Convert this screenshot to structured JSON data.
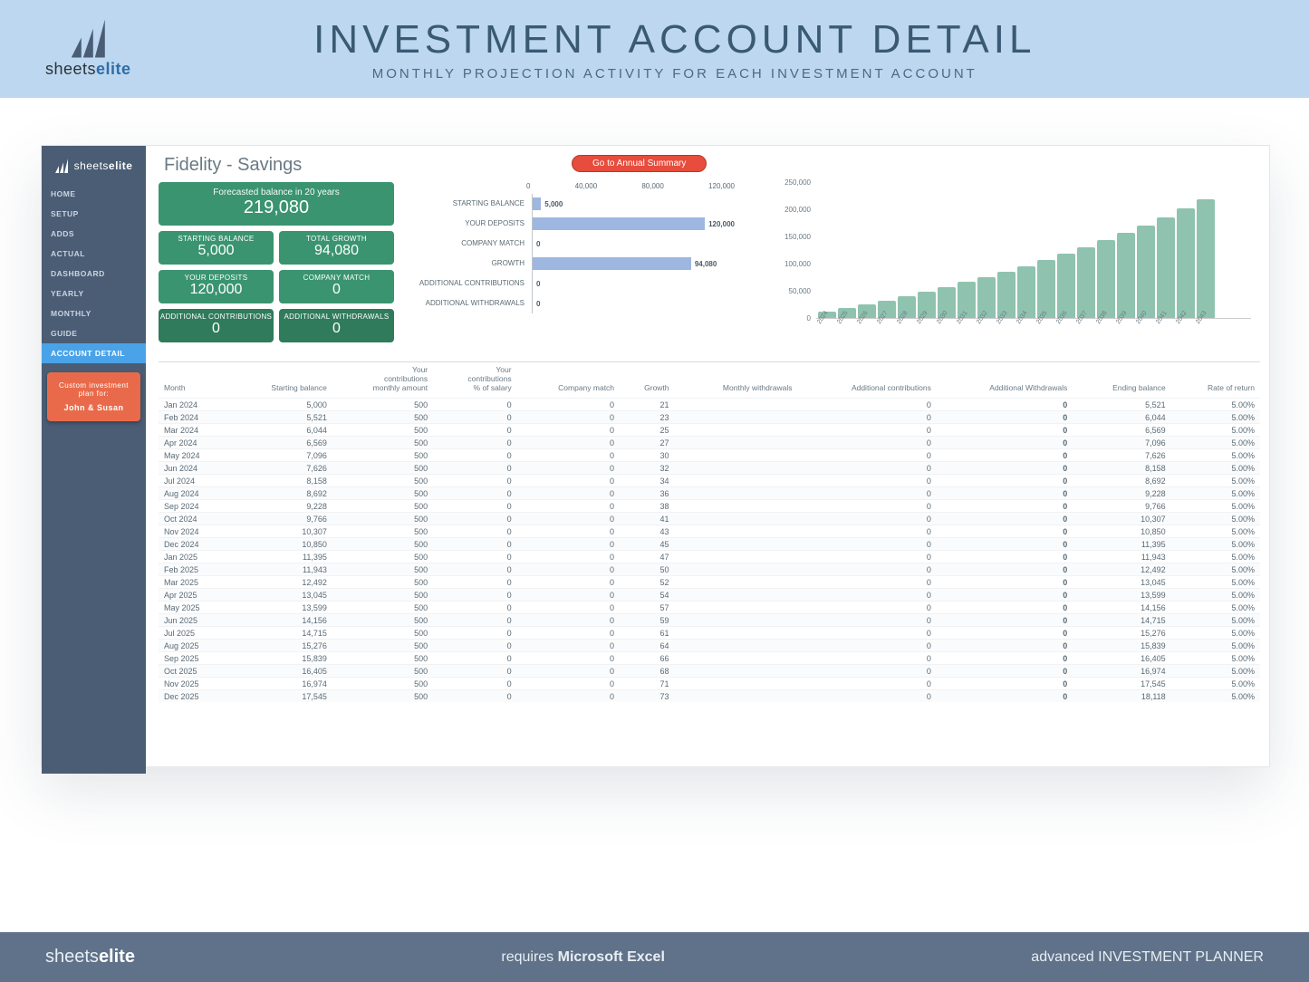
{
  "brand": {
    "a": "sheets",
    "b": "elite"
  },
  "banner": {
    "title": "INVESTMENT ACCOUNT DETAIL",
    "subtitle": "MONTHLY PROJECTION ACTIVITY FOR EACH INVESTMENT ACCOUNT"
  },
  "sidebar": {
    "items": [
      "HOME",
      "SETUP",
      "ADDS",
      "ACTUAL",
      "DASHBOARD",
      "YEARLY",
      "MONTHLY",
      "GUIDE",
      "ACCOUNT DETAIL"
    ],
    "active": "ACCOUNT DETAIL",
    "plan": {
      "label": "Custom investment plan for:",
      "name": "John & Susan"
    }
  },
  "account": {
    "title": "Fidelity - Savings"
  },
  "summary_btn": "Go to Annual Summary",
  "cards": {
    "forecast": {
      "label": "Forecasted balance in 20 years",
      "value": "219,080"
    },
    "starting": {
      "label": "STARTING BALANCE",
      "value": "5,000"
    },
    "growth": {
      "label": "TOTAL GROWTH",
      "value": "94,080"
    },
    "deposits": {
      "label": "YOUR DEPOSITS",
      "value": "120,000"
    },
    "match": {
      "label": "COMPANY MATCH",
      "value": "0"
    },
    "addc": {
      "label": "ADDITIONAL CONTRIBUTIONS",
      "value": "0"
    },
    "addw": {
      "label": "ADDITIONAL WITHDRAWALS",
      "value": "0"
    }
  },
  "chart_data": [
    {
      "type": "bar",
      "orientation": "horizontal",
      "categories": [
        "STARTING BALANCE",
        "YOUR DEPOSITS",
        "COMPANY MATCH",
        "GROWTH",
        "ADDITIONAL CONTRIBUTIONS",
        "ADDITIONAL WITHDRAWALS"
      ],
      "values": [
        5000,
        120000,
        0,
        94080,
        0,
        0
      ],
      "xticks": [
        "0",
        "40,000",
        "80,000",
        "120,000"
      ],
      "xmax": 120000
    },
    {
      "type": "bar",
      "orientation": "vertical",
      "categories": [
        "2024",
        "2025",
        "2026",
        "2027",
        "2028",
        "2029",
        "2030",
        "2031",
        "2032",
        "2033",
        "2034",
        "2035",
        "2036",
        "2037",
        "2038",
        "2039",
        "2040",
        "2041",
        "2042",
        "2043"
      ],
      "values": [
        11400,
        18100,
        25100,
        32500,
        40300,
        48400,
        57000,
        66000,
        75400,
        85300,
        95700,
        106700,
        118200,
        130300,
        143000,
        156400,
        170500,
        185300,
        200900,
        219080
      ],
      "yticks": [
        "0",
        "50,000",
        "100,000",
        "150,000",
        "200,000",
        "250,000"
      ],
      "ymax": 250000
    }
  ],
  "table": {
    "headers": [
      "Month",
      "Starting balance",
      "Your contributions - monthly amount",
      "Your contributions - % of salary",
      "Company match",
      "Growth",
      "Monthly withdrawals",
      "Additional contributions",
      "Additional Withdrawals",
      "Ending balance",
      "Rate of return"
    ],
    "rows": [
      [
        "Jan 2024",
        "5,000",
        "500",
        "0",
        "0",
        "21",
        "",
        "0",
        "0",
        "5,521",
        "5.00%"
      ],
      [
        "Feb 2024",
        "5,521",
        "500",
        "0",
        "0",
        "23",
        "",
        "0",
        "0",
        "6,044",
        "5.00%"
      ],
      [
        "Mar 2024",
        "6,044",
        "500",
        "0",
        "0",
        "25",
        "",
        "0",
        "0",
        "6,569",
        "5.00%"
      ],
      [
        "Apr 2024",
        "6,569",
        "500",
        "0",
        "0",
        "27",
        "",
        "0",
        "0",
        "7,096",
        "5.00%"
      ],
      [
        "May 2024",
        "7,096",
        "500",
        "0",
        "0",
        "30",
        "",
        "0",
        "0",
        "7,626",
        "5.00%"
      ],
      [
        "Jun 2024",
        "7,626",
        "500",
        "0",
        "0",
        "32",
        "",
        "0",
        "0",
        "8,158",
        "5.00%"
      ],
      [
        "Jul 2024",
        "8,158",
        "500",
        "0",
        "0",
        "34",
        "",
        "0",
        "0",
        "8,692",
        "5.00%"
      ],
      [
        "Aug 2024",
        "8,692",
        "500",
        "0",
        "0",
        "36",
        "",
        "0",
        "0",
        "9,228",
        "5.00%"
      ],
      [
        "Sep 2024",
        "9,228",
        "500",
        "0",
        "0",
        "38",
        "",
        "0",
        "0",
        "9,766",
        "5.00%"
      ],
      [
        "Oct 2024",
        "9,766",
        "500",
        "0",
        "0",
        "41",
        "",
        "0",
        "0",
        "10,307",
        "5.00%"
      ],
      [
        "Nov 2024",
        "10,307",
        "500",
        "0",
        "0",
        "43",
        "",
        "0",
        "0",
        "10,850",
        "5.00%"
      ],
      [
        "Dec 2024",
        "10,850",
        "500",
        "0",
        "0",
        "45",
        "",
        "0",
        "0",
        "11,395",
        "5.00%"
      ],
      [
        "Jan 2025",
        "11,395",
        "500",
        "0",
        "0",
        "47",
        "",
        "0",
        "0",
        "11,943",
        "5.00%"
      ],
      [
        "Feb 2025",
        "11,943",
        "500",
        "0",
        "0",
        "50",
        "",
        "0",
        "0",
        "12,492",
        "5.00%"
      ],
      [
        "Mar 2025",
        "12,492",
        "500",
        "0",
        "0",
        "52",
        "",
        "0",
        "0",
        "13,045",
        "5.00%"
      ],
      [
        "Apr 2025",
        "13,045",
        "500",
        "0",
        "0",
        "54",
        "",
        "0",
        "0",
        "13,599",
        "5.00%"
      ],
      [
        "May 2025",
        "13,599",
        "500",
        "0",
        "0",
        "57",
        "",
        "0",
        "0",
        "14,156",
        "5.00%"
      ],
      [
        "Jun 2025",
        "14,156",
        "500",
        "0",
        "0",
        "59",
        "",
        "0",
        "0",
        "14,715",
        "5.00%"
      ],
      [
        "Jul 2025",
        "14,715",
        "500",
        "0",
        "0",
        "61",
        "",
        "0",
        "0",
        "15,276",
        "5.00%"
      ],
      [
        "Aug 2025",
        "15,276",
        "500",
        "0",
        "0",
        "64",
        "",
        "0",
        "0",
        "15,839",
        "5.00%"
      ],
      [
        "Sep 2025",
        "15,839",
        "500",
        "0",
        "0",
        "66",
        "",
        "0",
        "0",
        "16,405",
        "5.00%"
      ],
      [
        "Oct 2025",
        "16,405",
        "500",
        "0",
        "0",
        "68",
        "",
        "0",
        "0",
        "16,974",
        "5.00%"
      ],
      [
        "Nov 2025",
        "16,974",
        "500",
        "0",
        "0",
        "71",
        "",
        "0",
        "0",
        "17,545",
        "5.00%"
      ],
      [
        "Dec 2025",
        "17,545",
        "500",
        "0",
        "0",
        "73",
        "",
        "0",
        "0",
        "18,118",
        "5.00%"
      ]
    ]
  },
  "footer": {
    "center_a": "requires ",
    "center_b": "Microsoft Excel",
    "right": "advanced INVESTMENT PLANNER"
  }
}
